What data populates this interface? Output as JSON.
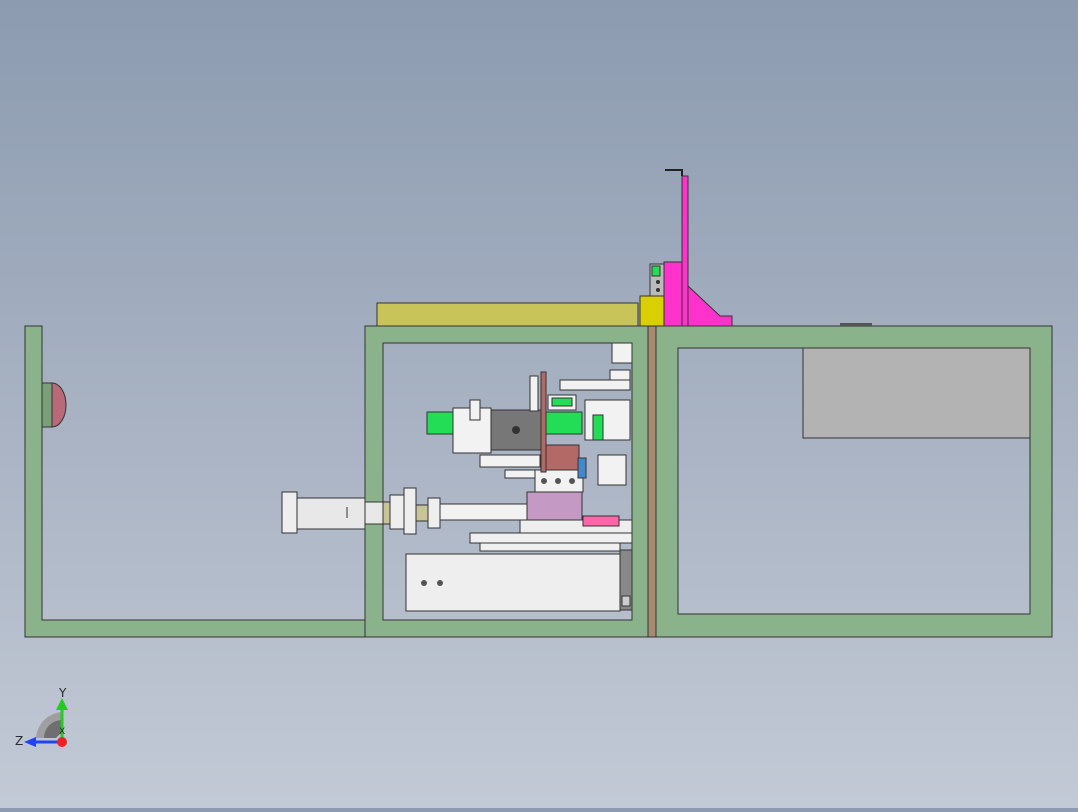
{
  "triad": {
    "y_label": "Y",
    "z_label": "Z",
    "x_label": "X"
  },
  "colors": {
    "frame": "#8bb38b",
    "frame_stroke": "#333333",
    "panel_grey": "#b3b3b3",
    "magenta": "#ff33cc",
    "olive": "#c8c45a",
    "yellow": "#d8d000",
    "bright_green": "#22dd55",
    "brown": "#b36a66",
    "purple": "#c499c4",
    "pink": "#ff66aa",
    "light_part": "#eeeeee",
    "cylinder": "#e8e8e8",
    "axis_y": "#22cc22",
    "axis_z": "#2244ee",
    "axis_x": "#ee2222"
  }
}
